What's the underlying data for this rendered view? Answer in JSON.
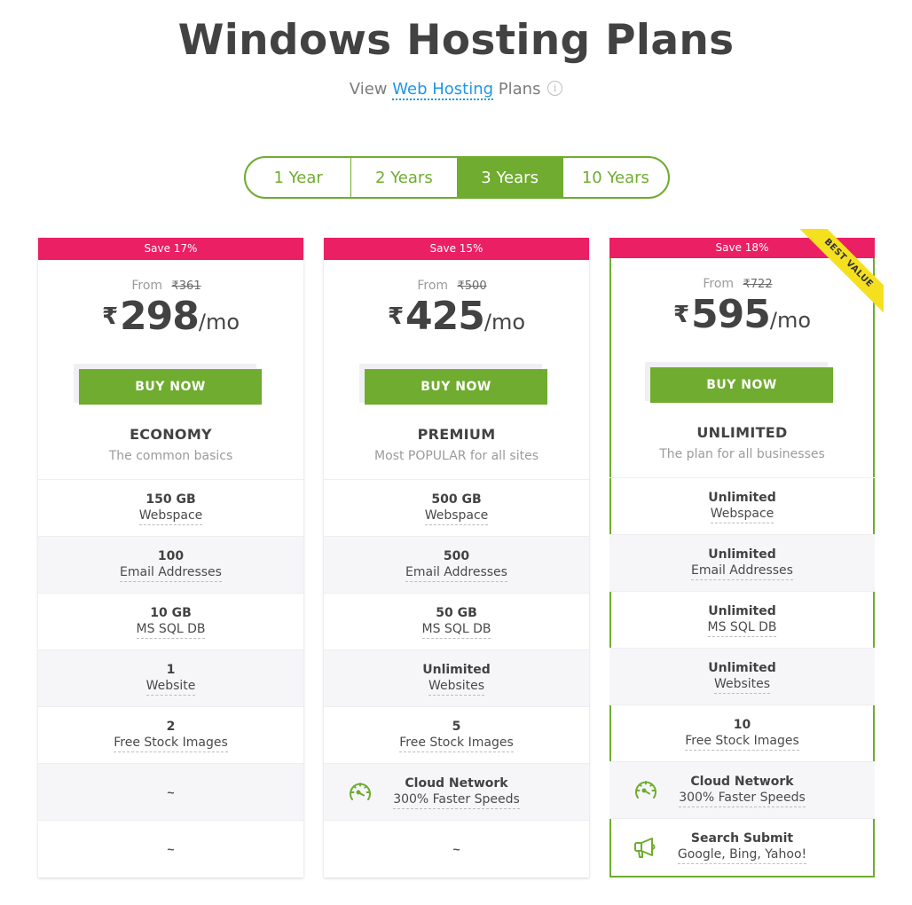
{
  "header": {
    "title": "Windows Hosting Plans",
    "subtitle_prefix": "View",
    "subtitle_link": "Web Hosting",
    "subtitle_suffix": "Plans",
    "info_icon": "i"
  },
  "tenure_tabs": [
    {
      "label": "1 Year",
      "active": false
    },
    {
      "label": "2 Years",
      "active": false
    },
    {
      "label": "3 Years",
      "active": true
    },
    {
      "label": "10 Years",
      "active": false
    }
  ],
  "colors": {
    "accent_green": "#6fac2f",
    "save_pink": "#eb1f63",
    "ribbon_yellow": "#f5e020",
    "link_blue": "#1e96e6"
  },
  "plans": [
    {
      "save": "Save 17%",
      "from_label": "From",
      "old_price": "₹361",
      "currency": "₹",
      "price": "298",
      "per": "/mo",
      "buy_label": "BUY NOW",
      "name": "ECONOMY",
      "desc": "The common basics",
      "features": [
        {
          "value": "150 GB",
          "label": "Webspace"
        },
        {
          "value": "100",
          "label": "Email Addresses"
        },
        {
          "value": "10 GB",
          "label": "MS SQL DB"
        },
        {
          "value": "1",
          "label": "Website"
        },
        {
          "value": "2",
          "label": "Free Stock Images"
        },
        {
          "value": "~",
          "label": ""
        },
        {
          "value": "~",
          "label": ""
        }
      ]
    },
    {
      "save": "Save 15%",
      "from_label": "From",
      "old_price": "₹500",
      "currency": "₹",
      "price": "425",
      "per": "/mo",
      "buy_label": "BUY NOW",
      "name": "PREMIUM",
      "desc": "Most POPULAR for all sites",
      "features": [
        {
          "value": "500 GB",
          "label": "Webspace"
        },
        {
          "value": "500",
          "label": "Email Addresses"
        },
        {
          "value": "50 GB",
          "label": "MS SQL DB"
        },
        {
          "value": "Unlimited",
          "label": "Websites"
        },
        {
          "value": "5",
          "label": "Free Stock Images"
        },
        {
          "value": "Cloud Network",
          "label": "300% Faster Speeds",
          "icon": "speedometer-icon"
        },
        {
          "value": "~",
          "label": ""
        }
      ]
    },
    {
      "save": "Save 18%",
      "ribbon": "BEST VALUE",
      "from_label": "From",
      "old_price": "₹722",
      "currency": "₹",
      "price": "595",
      "per": "/mo",
      "buy_label": "BUY NOW",
      "name": "UNLIMITED",
      "desc": "The plan for all businesses",
      "features": [
        {
          "value": "Unlimited",
          "label": "Webspace"
        },
        {
          "value": "Unlimited",
          "label": "Email Addresses"
        },
        {
          "value": "Unlimited",
          "label": "MS SQL DB"
        },
        {
          "value": "Unlimited",
          "label": "Websites"
        },
        {
          "value": "10",
          "label": "Free Stock Images"
        },
        {
          "value": "Cloud Network",
          "label": "300% Faster Speeds",
          "icon": "speedometer-icon"
        },
        {
          "value": "Search Submit",
          "label": "Google, Bing, Yahoo!",
          "icon": "megaphone-icon"
        }
      ]
    }
  ]
}
